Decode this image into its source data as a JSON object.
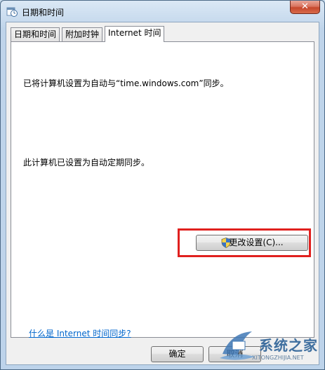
{
  "window": {
    "title": "日期和时间",
    "close_label": "✕"
  },
  "tabs": [
    {
      "label": "日期和时间",
      "active": false
    },
    {
      "label": "附加时钟",
      "active": false
    },
    {
      "label": "Internet 时间",
      "active": true
    }
  ],
  "panel": {
    "sync_status": "已将计算机设置为自动与“time.windows.com”同步。",
    "schedule_status": "此计算机已设置为自动定期同步。",
    "change_settings_label": "更改设置(C)...",
    "help_link": "什么是 Internet 时间同步?"
  },
  "footer": {
    "ok_label": "确定",
    "cancel_label": "取消"
  },
  "watermark": {
    "text": "系统之家",
    "sub": "XITONGZHIJIA.NET"
  },
  "colors": {
    "highlight": "#e0201e",
    "link": "#0066cc"
  }
}
